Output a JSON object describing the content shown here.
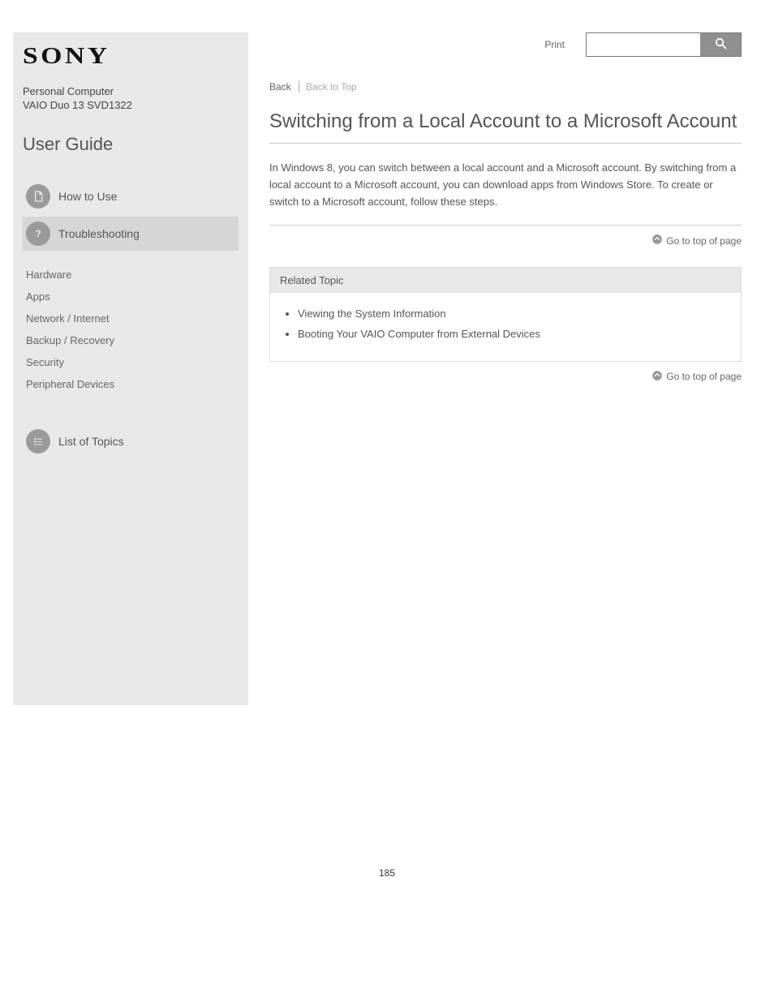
{
  "brand": "SONY",
  "product": {
    "name": "Personal Computer",
    "model": "VAIO Duo 13 SVD1322"
  },
  "user_guide_label": "User Guide",
  "nav": {
    "how_to_use": "How to Use",
    "troubleshooting": "Troubleshooting",
    "list_of_topics": "List of Topics"
  },
  "subnav": {
    "hardware": "Hardware",
    "apps": "Apps",
    "network": "Network / Internet",
    "backup": "Backup / Recovery",
    "security": "Security",
    "peripheral": "Peripheral Devices"
  },
  "top": {
    "print": "Print",
    "search_placeholder": ""
  },
  "breadcrumb": {
    "back": "Back",
    "back_to_top": "Back to Top"
  },
  "article": {
    "title": "Switching from a Local Account to a Microsoft Account",
    "body": "In Windows 8, you can switch between a local account and a Microsoft account. By switching from a local account to a Microsoft account, you can download apps from Windows Store. To create or switch to a Microsoft account, follow these steps."
  },
  "go_to_top": "Go to top of page",
  "related": {
    "header": "Related Topic",
    "items": [
      "Viewing the System Information",
      "Booting Your VAIO Computer from External Devices"
    ]
  },
  "page_number": "185"
}
